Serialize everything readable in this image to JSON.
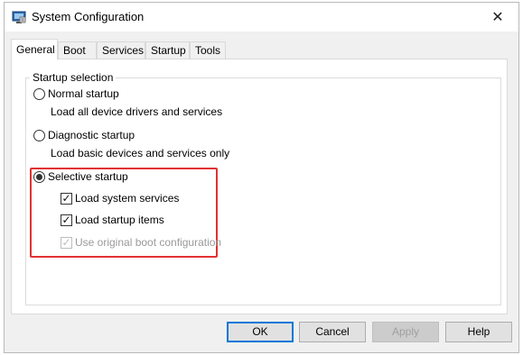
{
  "window": {
    "title": "System Configuration",
    "app_icon": "msconfig-icon",
    "close_glyph": "✕"
  },
  "tabs": [
    {
      "label": "General",
      "active": true
    },
    {
      "label": "Boot",
      "active": false
    },
    {
      "label": "Services",
      "active": false
    },
    {
      "label": "Startup",
      "active": false
    },
    {
      "label": "Tools",
      "active": false
    }
  ],
  "general": {
    "group_label": "Startup selection",
    "normal": {
      "label": "Normal startup",
      "description": "Load all device drivers and services",
      "selected": false
    },
    "diagnostic": {
      "label": "Diagnostic startup",
      "description": "Load basic devices and services only",
      "selected": false
    },
    "selective": {
      "label": "Selective startup",
      "selected": true,
      "options": {
        "system_services": {
          "label": "Load system services",
          "checked": true,
          "enabled": true
        },
        "startup_items": {
          "label": "Load startup items",
          "checked": true,
          "enabled": true
        },
        "original_boot": {
          "label": "Use original boot configuration",
          "checked": true,
          "enabled": false
        }
      }
    }
  },
  "buttons": {
    "ok": "OK",
    "cancel": "Cancel",
    "apply": "Apply",
    "help": "Help"
  },
  "colors": {
    "highlight_border": "#e23131",
    "default_button_border": "#0078d7"
  }
}
